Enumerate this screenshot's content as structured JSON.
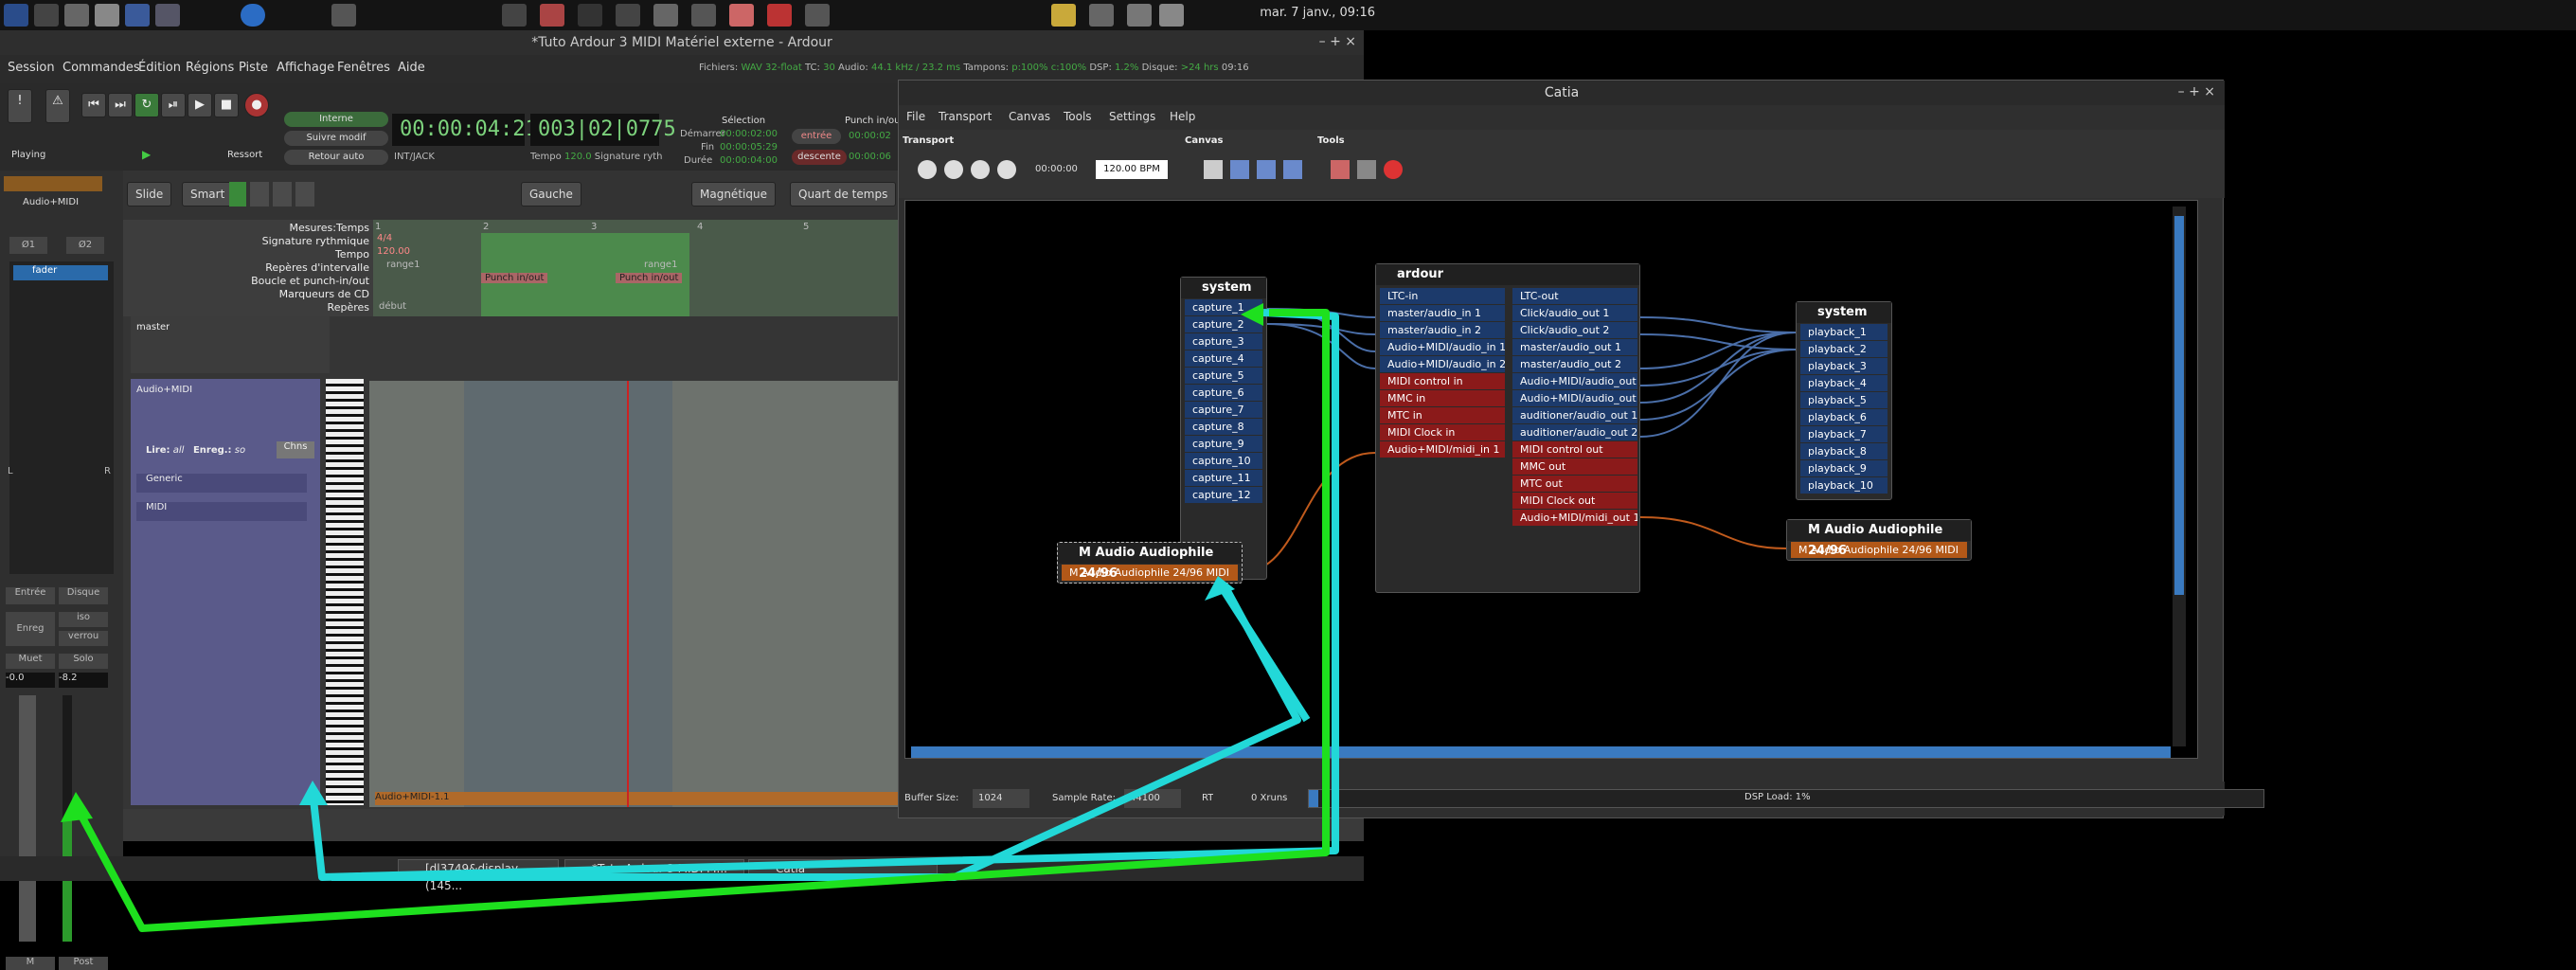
{
  "topbar": {
    "clock": "mar. 7 janv., 09:16"
  },
  "ardour": {
    "title": "*Tuto Ardour 3 MIDI Matériel externe - Ardour",
    "status": {
      "files_label": "Fichiers:",
      "files_value": "WAV 32-float",
      "tc_label": "TC:",
      "tc_value": "30",
      "audio_label": "Audio:",
      "audio_value": "44.1 kHz / 23.2 ms",
      "buffers_label": "Tampons:",
      "buffers_value": "p:100% c:100%",
      "dsp_label": "DSP:",
      "dsp_value": "1.2%",
      "disk_label": "Disque:",
      "disk_value": ">24 hrs",
      "time": "09:16"
    },
    "menu": [
      "Session",
      "Commandes",
      "Édition",
      "Régions",
      "Piste",
      "Affichage",
      "Fenêtres",
      "Aide"
    ],
    "transport": {
      "state": "Playing",
      "ressort": "Ressort",
      "interne": "Interne",
      "suivre": "Suivre modif",
      "retour": "Retour auto",
      "clock1": "00:00:04:21",
      "clock1_sub": "INT/JACK",
      "clock2": "003|02|0775",
      "tempo_label": "Tempo",
      "tempo_val": "120.0",
      "sig_label": "Signature ryth",
      "selection_title": "Sélection",
      "punch_title": "Punch in/out",
      "start_label": "Démarrer",
      "start_val": "00:00:02:00",
      "end_label": "Fin",
      "end_val": "00:00:05:29",
      "dur_label": "Durée",
      "dur_val": "00:00:04:00",
      "entree": "entrée",
      "descente": "descente",
      "punch_in": "00:00:02",
      "punch_out": "00:00:06"
    },
    "edit_toolbar": {
      "mode": "Slide",
      "smart": "Smart",
      "gauche": "Gauche",
      "magnetique": "Magnétique",
      "grid": "Quart de temps"
    },
    "rulers": [
      "Mesures:Temps",
      "Signature rythmique",
      "Tempo",
      "Repères d'intervalle",
      "Boucle et punch-in/out",
      "Marqueurs de CD",
      "Repères"
    ],
    "ruler_values": {
      "sig": "4/4",
      "tempo": "120.00",
      "range1": "range1",
      "range1b": "range1",
      "punch1": "Punch in/out",
      "punch2": "Punch in/out",
      "debut": "début",
      "bars": [
        "1",
        "2",
        "3",
        "4",
        "5"
      ]
    },
    "mixer": {
      "name": "Audio+MIDI",
      "b1": "Ø1",
      "b2": "Ø2",
      "fader": "fader",
      "in": "Entrée",
      "disk": "Disque",
      "rec": "Enreg",
      "iso": "iso",
      "lock": "verrou",
      "mute": "Muet",
      "solo": "Solo",
      "gain1": "-0.0",
      "gain2": "-8.2",
      "m": "M",
      "post": "Post",
      "L": "L",
      "R": "R"
    },
    "tracks": {
      "master": "master",
      "midi_track": "Audio+MIDI",
      "lire": "Lire:",
      "lire_val": "all",
      "enreg": "Enreg.:",
      "enreg_val": "so",
      "chns": "Chns",
      "generic": "Generic",
      "midi": "MIDI",
      "region": "Audio+MIDI-1.1"
    },
    "taskbar": [
      "[dl3749&display (145...",
      "*Tuto Ardour 3 MIDI M...",
      "Catia"
    ]
  },
  "catia": {
    "title": "Catia",
    "menu": [
      "File",
      "Transport",
      "Canvas",
      "Tools",
      "Settings",
      "Help"
    ],
    "sections": [
      "Transport",
      "Canvas",
      "Tools"
    ],
    "time": "00:00:00",
    "bpm": "120.00 BPM",
    "system_in": {
      "name": "system",
      "ports": [
        "capture_1",
        "capture_2",
        "capture_3",
        "capture_4",
        "capture_5",
        "capture_6",
        "capture_7",
        "capture_8",
        "capture_9",
        "capture_10",
        "capture_11",
        "capture_12"
      ]
    },
    "ardour": {
      "name": "ardour",
      "in_ports": [
        "LTC-in",
        "master/audio_in 1",
        "master/audio_in 2",
        "Audio+MIDI/audio_in 1",
        "Audio+MIDI/audio_in 2",
        "MIDI control in",
        "MMC in",
        "MTC in",
        "MIDI Clock in",
        "Audio+MIDI/midi_in 1"
      ],
      "out_ports": [
        "LTC-out",
        "Click/audio_out 1",
        "Click/audio_out 2",
        "master/audio_out 1",
        "master/audio_out 2",
        "Audio+MIDI/audio_out 1",
        "Audio+MIDI/audio_out 2",
        "auditioner/audio_out 1",
        "auditioner/audio_out 2",
        "MIDI control out",
        "MMC out",
        "MTC out",
        "MIDI Clock out",
        "Audio+MIDI/midi_out 1"
      ]
    },
    "system_out": {
      "name": "system",
      "ports": [
        "playback_1",
        "playback_2",
        "playback_3",
        "playback_4",
        "playback_5",
        "playback_6",
        "playback_7",
        "playback_8",
        "playback_9",
        "playback_10"
      ]
    },
    "maudio_in": {
      "name": "M Audio Audiophile 24/96",
      "port": "M Audio Audiophile 24/96 MIDI"
    },
    "maudio_out": {
      "name": "M Audio Audiophile 24/96",
      "port": "M Audio Audiophile 24/96 MIDI"
    },
    "status": {
      "buffer_label": "Buffer Size:",
      "buffer_val": "1024",
      "rate_label": "Sample Rate:",
      "rate_val": "44100",
      "rt": "RT",
      "xruns": "0 Xruns",
      "dsp": "DSP Load: 1%"
    }
  },
  "colors": {
    "arrow_green": "#1ee01e",
    "arrow_cyan": "#22d8d8",
    "audio_port": "#1c3a6b",
    "midi_port": "#8b1a1a",
    "hw_port": "#b25818"
  }
}
